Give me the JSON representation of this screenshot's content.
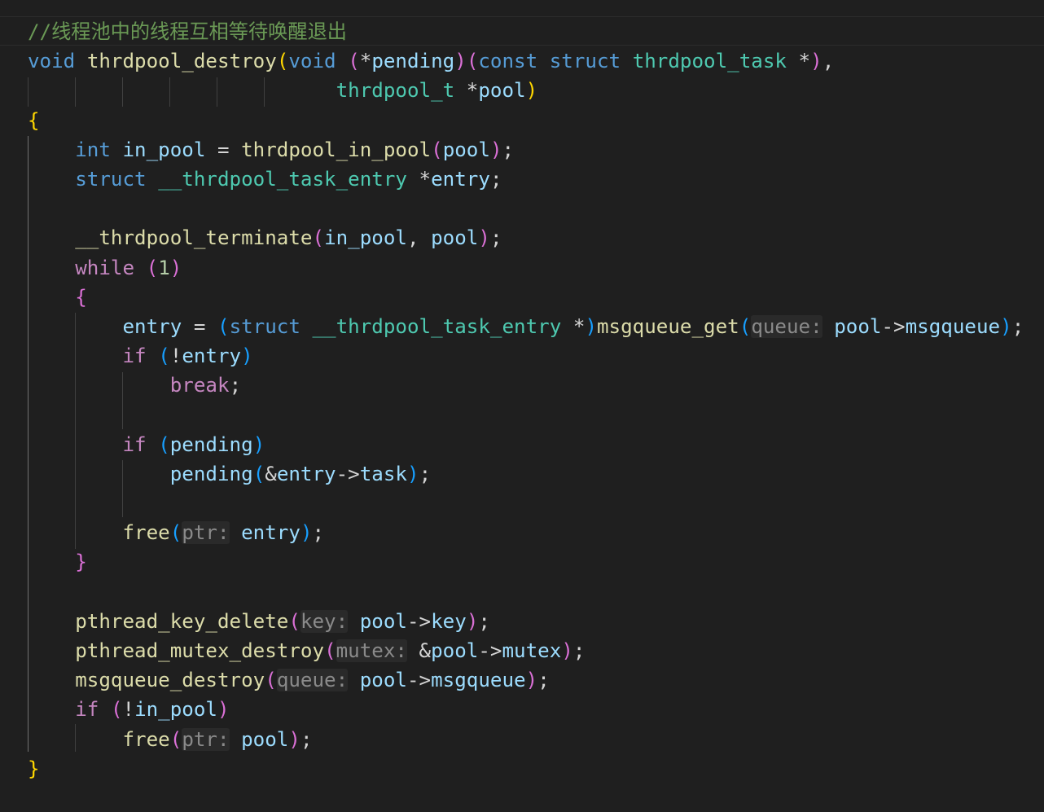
{
  "editor": {
    "language": "c",
    "theme": "dark",
    "colors": {
      "background": "#1f1f1f",
      "keyword": "#569cd6",
      "control": "#c586c0",
      "type": "#4ec9b0",
      "function": "#dcdcaa",
      "variable": "#9cdcfe",
      "number": "#b5cea8",
      "comment": "#6a9955",
      "bracket_level_1": "#ffd700",
      "bracket_level_2": "#da70d6",
      "bracket_level_3": "#179fff"
    }
  },
  "code": {
    "comment": "//线程池中的线程互相等待唤醒退出",
    "kw_void": "void",
    "kw_int": "int",
    "kw_struct": "struct",
    "kw_const": "const",
    "kw_while": "while",
    "kw_if": "if",
    "kw_break": "break",
    "fn_destroy": "thrdpool_destroy",
    "fn_in_pool": "thrdpool_in_pool",
    "fn_terminate": "__thrdpool_terminate",
    "fn_msgqueue_get": "msgqueue_get",
    "fn_free": "free",
    "fn_key_delete": "pthread_key_delete",
    "fn_mutex_destroy": "pthread_mutex_destroy",
    "fn_msgqueue_destroy": "msgqueue_destroy",
    "ty_task": "thrdpool_task",
    "ty_pool": "thrdpool_t",
    "ty_entry": "__thrdpool_task_entry",
    "var_pending": "pending",
    "var_pool": "pool",
    "var_in_pool": "in_pool",
    "var_entry": "entry",
    "var_task": "task",
    "var_msgqueue": "msgqueue",
    "var_key": "key",
    "var_mutex": "mutex",
    "num_1": "1",
    "hint_queue": "queue:",
    "hint_ptr": "ptr:",
    "hint_key": "key:",
    "hint_mutex": "mutex:"
  }
}
